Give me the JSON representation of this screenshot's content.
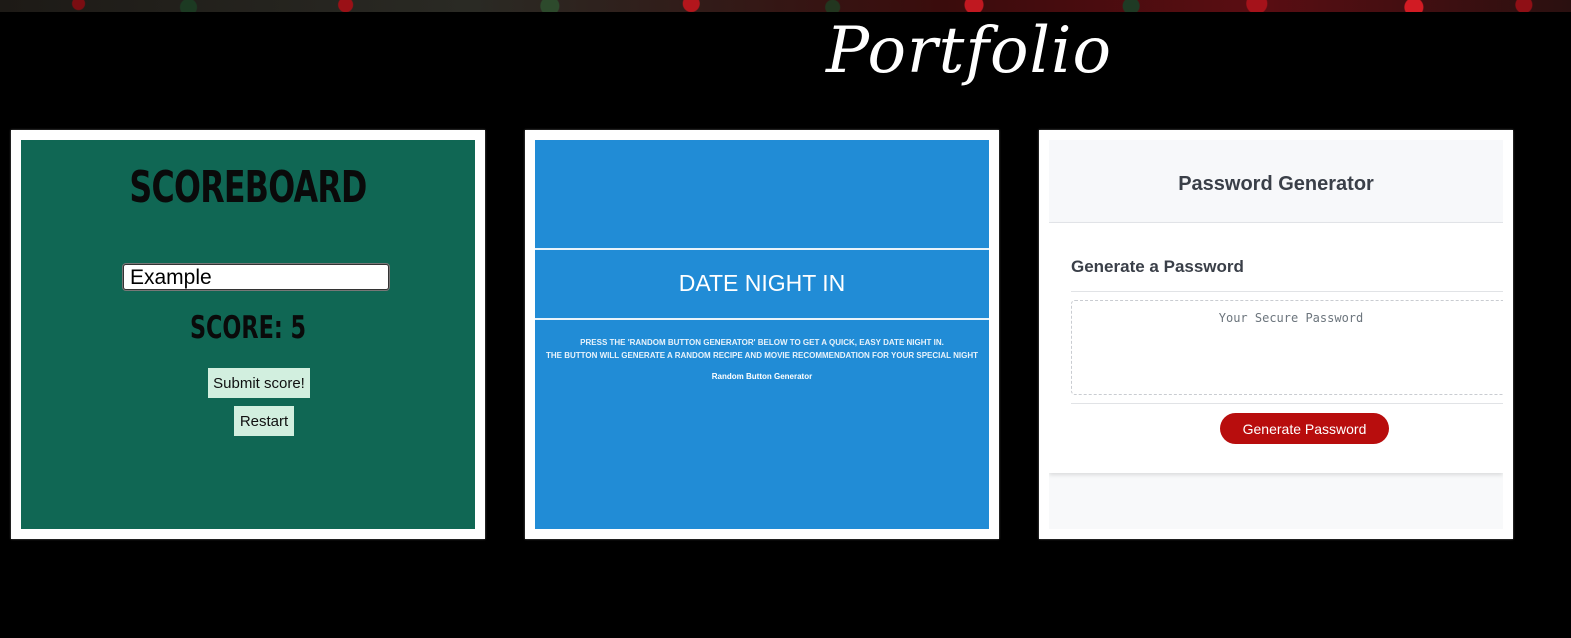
{
  "page": {
    "title": "Portfolio"
  },
  "cards": [
    {
      "name": "scoreboard",
      "title": "SCOREBOARD",
      "input_value": "Example",
      "score_text": "SCORE: 5",
      "submit_label": "Submit score!",
      "restart_label": "Restart",
      "bg_color": "#106754"
    },
    {
      "name": "date-night-in",
      "title": "DATE NIGHT IN",
      "line1": "PRESS THE 'RANDOM BUTTON GENERATOR' BELOW TO GET A QUICK, EASY DATE NIGHT IN.",
      "line2": "THE BUTTON WILL GENERATE A RANDOM RECIPE AND MOVIE RECOMMENDATION FOR YOUR SPECIAL NIGHT",
      "button_label": "Random Button Generator",
      "bg_color": "#218cd6"
    },
    {
      "name": "password-generator",
      "header": "Password Generator",
      "subheader": "Generate a Password",
      "placeholder": "Your Secure Password",
      "button_label": "Generate Password",
      "button_color": "#b80d0d"
    }
  ]
}
